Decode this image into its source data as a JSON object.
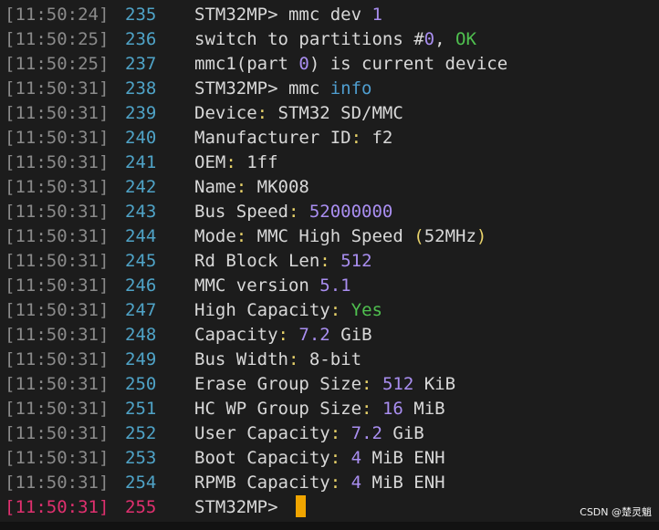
{
  "terminal": {
    "lines": [
      {
        "timestamp": "[11:50:24]",
        "line_no": "235",
        "segments": [
          {
            "text": "STM32MP> mmc dev ",
            "color": "default"
          },
          {
            "text": "1",
            "color": "number"
          }
        ]
      },
      {
        "timestamp": "[11:50:25]",
        "line_no": "236",
        "segments": [
          {
            "text": "switch to partitions #",
            "color": "default"
          },
          {
            "text": "0",
            "color": "number"
          },
          {
            "text": ", ",
            "color": "default"
          },
          {
            "text": "OK",
            "color": "ok"
          }
        ]
      },
      {
        "timestamp": "[11:50:25]",
        "line_no": "237",
        "segments": [
          {
            "text": "mmc1(part ",
            "color": "default"
          },
          {
            "text": "0",
            "color": "number"
          },
          {
            "text": ") is current device",
            "color": "default"
          }
        ]
      },
      {
        "timestamp": "[11:50:31]",
        "line_no": "238",
        "segments": [
          {
            "text": "STM32MP> mmc ",
            "color": "default"
          },
          {
            "text": "info",
            "color": "keyword"
          }
        ]
      },
      {
        "timestamp": "[11:50:31]",
        "line_no": "239",
        "segments": [
          {
            "text": "Device",
            "color": "default"
          },
          {
            "text": ":",
            "color": "punct"
          },
          {
            "text": " STM32 SD/MMC",
            "color": "default"
          }
        ]
      },
      {
        "timestamp": "[11:50:31]",
        "line_no": "240",
        "segments": [
          {
            "text": "Manufacturer ID",
            "color": "default"
          },
          {
            "text": ":",
            "color": "punct"
          },
          {
            "text": " f2",
            "color": "default"
          }
        ]
      },
      {
        "timestamp": "[11:50:31]",
        "line_no": "241",
        "segments": [
          {
            "text": "OEM",
            "color": "default"
          },
          {
            "text": ":",
            "color": "punct"
          },
          {
            "text": " 1ff",
            "color": "default"
          }
        ]
      },
      {
        "timestamp": "[11:50:31]",
        "line_no": "242",
        "segments": [
          {
            "text": "Name",
            "color": "default"
          },
          {
            "text": ":",
            "color": "punct"
          },
          {
            "text": " MK008",
            "color": "default"
          }
        ]
      },
      {
        "timestamp": "[11:50:31]",
        "line_no": "243",
        "segments": [
          {
            "text": "Bus Speed",
            "color": "default"
          },
          {
            "text": ":",
            "color": "punct"
          },
          {
            "text": " ",
            "color": "default"
          },
          {
            "text": "52000000",
            "color": "number"
          }
        ]
      },
      {
        "timestamp": "[11:50:31]",
        "line_no": "244",
        "segments": [
          {
            "text": "Mode",
            "color": "default"
          },
          {
            "text": ":",
            "color": "punct"
          },
          {
            "text": " MMC High Speed ",
            "color": "default"
          },
          {
            "text": "(",
            "color": "punct"
          },
          {
            "text": "52MHz",
            "color": "default"
          },
          {
            "text": ")",
            "color": "punct"
          }
        ]
      },
      {
        "timestamp": "[11:50:31]",
        "line_no": "245",
        "segments": [
          {
            "text": "Rd Block Len",
            "color": "default"
          },
          {
            "text": ":",
            "color": "punct"
          },
          {
            "text": " ",
            "color": "default"
          },
          {
            "text": "512",
            "color": "number"
          }
        ]
      },
      {
        "timestamp": "[11:50:31]",
        "line_no": "246",
        "segments": [
          {
            "text": "MMC version ",
            "color": "default"
          },
          {
            "text": "5.1",
            "color": "number"
          }
        ]
      },
      {
        "timestamp": "[11:50:31]",
        "line_no": "247",
        "segments": [
          {
            "text": "High Capacity",
            "color": "default"
          },
          {
            "text": ":",
            "color": "punct"
          },
          {
            "text": " ",
            "color": "default"
          },
          {
            "text": "Yes",
            "color": "ok"
          }
        ]
      },
      {
        "timestamp": "[11:50:31]",
        "line_no": "248",
        "segments": [
          {
            "text": "Capacity",
            "color": "default"
          },
          {
            "text": ":",
            "color": "punct"
          },
          {
            "text": " ",
            "color": "default"
          },
          {
            "text": "7.2",
            "color": "number"
          },
          {
            "text": " GiB",
            "color": "default"
          }
        ]
      },
      {
        "timestamp": "[11:50:31]",
        "line_no": "249",
        "segments": [
          {
            "text": "Bus Width",
            "color": "default"
          },
          {
            "text": ":",
            "color": "punct"
          },
          {
            "text": " 8-bit",
            "color": "default"
          }
        ]
      },
      {
        "timestamp": "[11:50:31]",
        "line_no": "250",
        "segments": [
          {
            "text": "Erase Group Size",
            "color": "default"
          },
          {
            "text": ":",
            "color": "punct"
          },
          {
            "text": " ",
            "color": "default"
          },
          {
            "text": "512",
            "color": "number"
          },
          {
            "text": " KiB",
            "color": "default"
          }
        ]
      },
      {
        "timestamp": "[11:50:31]",
        "line_no": "251",
        "segments": [
          {
            "text": "HC WP Group Size",
            "color": "default"
          },
          {
            "text": ":",
            "color": "punct"
          },
          {
            "text": " ",
            "color": "default"
          },
          {
            "text": "16",
            "color": "number"
          },
          {
            "text": " MiB",
            "color": "default"
          }
        ]
      },
      {
        "timestamp": "[11:50:31]",
        "line_no": "252",
        "segments": [
          {
            "text": "User Capacity",
            "color": "default"
          },
          {
            "text": ":",
            "color": "punct"
          },
          {
            "text": " ",
            "color": "default"
          },
          {
            "text": "7.2",
            "color": "number"
          },
          {
            "text": " GiB",
            "color": "default"
          }
        ]
      },
      {
        "timestamp": "[11:50:31]",
        "line_no": "253",
        "segments": [
          {
            "text": "Boot Capacity",
            "color": "default"
          },
          {
            "text": ":",
            "color": "punct"
          },
          {
            "text": " ",
            "color": "default"
          },
          {
            "text": "4",
            "color": "number"
          },
          {
            "text": " MiB ENH",
            "color": "default"
          }
        ]
      },
      {
        "timestamp": "[11:50:31]",
        "line_no": "254",
        "segments": [
          {
            "text": "RPMB Capacity",
            "color": "default"
          },
          {
            "text": ":",
            "color": "punct"
          },
          {
            "text": " ",
            "color": "default"
          },
          {
            "text": "4",
            "color": "number"
          },
          {
            "text": " MiB ENH",
            "color": "default"
          }
        ]
      },
      {
        "timestamp": "[11:50:31]",
        "line_no": "255",
        "segments": [
          {
            "text": "STM32MP> ",
            "color": "default"
          }
        ],
        "current": true,
        "cursor": true
      }
    ]
  },
  "watermark": "CSDN @楚灵魈",
  "colors": {
    "background": "#1c1c1c",
    "timestamp": "#8a8a8a",
    "line_number": "#4fa3c7",
    "current_line_marker": "#e0306f",
    "text": "#d8d8d8",
    "number": "#a98ef0",
    "ok": "#4fc04f",
    "keyword": "#4f9ed0",
    "punct": "#e8d26a",
    "cursor": "#f0a500"
  }
}
